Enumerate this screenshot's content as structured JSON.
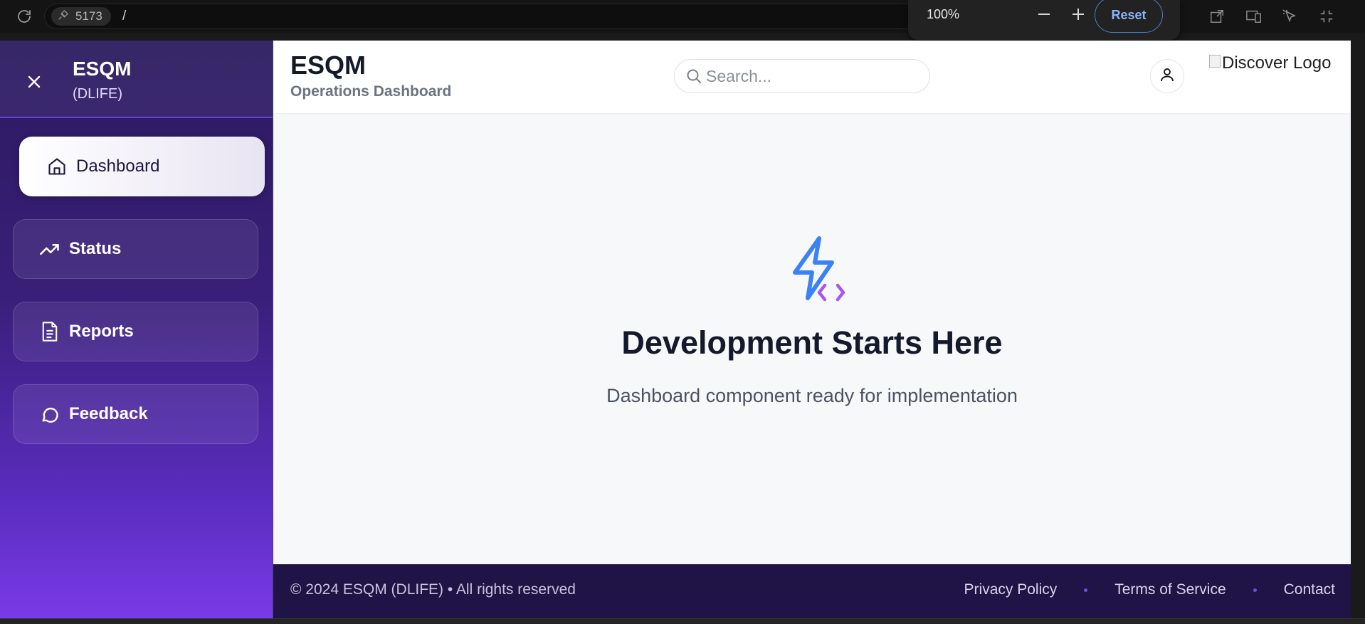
{
  "browser": {
    "port_label": "5173",
    "url_path": "/",
    "zoom": {
      "level": "100%",
      "reset_label": "Reset"
    },
    "icons": [
      "reload-icon",
      "plug-icon",
      "zoom-out-icon",
      "zoom-in-icon",
      "open-external-icon",
      "device-toolbar-icon",
      "inspect-cursor-icon",
      "exit-fullscreen-icon"
    ]
  },
  "sidebar": {
    "brand_title": "ESQM",
    "brand_subtitle": "(DLIFE)",
    "close_icon": "close-icon",
    "items": [
      {
        "label": "Dashboard",
        "icon": "home-icon",
        "active": true
      },
      {
        "label": "Status",
        "icon": "trending-up-icon",
        "active": false
      },
      {
        "label": "Reports",
        "icon": "document-icon",
        "active": false
      },
      {
        "label": "Feedback",
        "icon": "message-circle-icon",
        "active": false
      }
    ],
    "colors": {
      "gradient_top": "#2a1a5e",
      "gradient_bottom": "#7a3ae6"
    }
  },
  "header": {
    "title": "ESQM",
    "subtitle": "Operations Dashboard",
    "search": {
      "placeholder": "Search..."
    },
    "logo_alt": "Discover Logo"
  },
  "content": {
    "title": "Development Starts Here",
    "description": "Dashboard component ready for implementation",
    "icon": "zap-code-icon",
    "colors": {
      "zap": "#3b82f6",
      "code": "#a855f7"
    }
  },
  "footer": {
    "copyright": "© 2024 ESQM (DLIFE) • All rights reserved",
    "links": [
      "Privacy Policy",
      "Terms of Service",
      "Contact"
    ],
    "colors": {
      "background": "#1f1445",
      "dot": "#6d4de0"
    }
  }
}
